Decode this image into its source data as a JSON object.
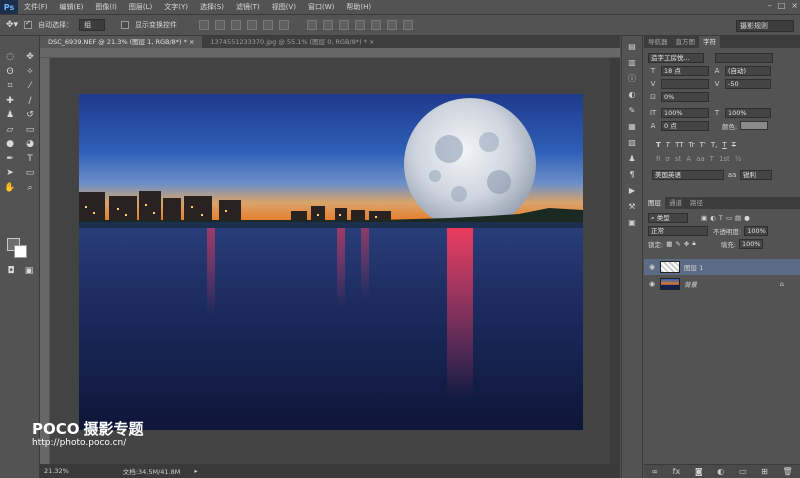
{
  "app": {
    "logo": "Ps"
  },
  "menu": [
    "文件(F)",
    "编辑(E)",
    "图像(I)",
    "图层(L)",
    "文字(Y)",
    "选择(S)",
    "滤镜(T)",
    "视图(V)",
    "窗口(W)",
    "帮助(H)"
  ],
  "options": {
    "auto_select_label": "自动选择：",
    "auto_select_value": "组",
    "show_transform_label": "显示变换控件",
    "workspace": "摄影规则"
  },
  "tabs": [
    {
      "label": "DSC_6939.NEF @ 21.3% (图层 1, RGB/8*) *  ×"
    },
    {
      "label": "1374551233370.jpg @ 55.1% (图层 0, RGB/8*) *  ×"
    }
  ],
  "status": {
    "zoom": "21.32%",
    "doc": "文档:34.5M/41.8M"
  },
  "watermark": {
    "brand": "POCO",
    "title": "摄影专题",
    "url": "http://photo.poco.cn/"
  },
  "panel_tabs": [
    "导航器",
    "直方图",
    "字符"
  ],
  "character": {
    "font": "造字工房悦...",
    "size": "18 点",
    "leading": "(自动)",
    "tracking": "-50",
    "scale_pct": "0%",
    "vscale": "100%",
    "hscale": "100%",
    "baseline": "0 点",
    "color_label": "颜色:",
    "language": "美国英语",
    "aa": "锐利",
    "format_buttons": [
      "T",
      "T",
      "TT",
      "Tr",
      "T'",
      "T,",
      "T",
      "T"
    ]
  },
  "layers_panel": {
    "tabs": [
      "图层",
      "通道",
      "路径"
    ],
    "filter": "类型",
    "blend_mode": "正常",
    "opacity_label": "不透明度:",
    "opacity": "100%",
    "lock_label": "锁定:",
    "fill_label": "填充:",
    "fill": "100%",
    "layers": [
      {
        "name": "图层 1"
      },
      {
        "name": "背景"
      }
    ]
  },
  "colors": {
    "ui": "#535353",
    "sky_top": "#1f3b8c",
    "horizon": "#e07a2a",
    "water": "#14204a"
  }
}
